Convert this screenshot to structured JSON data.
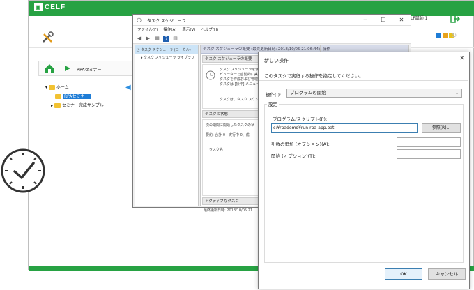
{
  "celf": {
    "logo": "CELF",
    "user": "CELF講師 1",
    "breadcrumb": "RPAセミナー",
    "tree": [
      {
        "label": "ホーム"
      },
      {
        "label": "RPAセミナー",
        "selected": true
      },
      {
        "label": "セミナー完成サンプル"
      }
    ],
    "brand_color": "#27a243"
  },
  "task_scheduler": {
    "title": "タスク スケジューラ",
    "menu": [
      "ファイル(F)",
      "操作(A)",
      "表示(V)",
      "ヘルプ(H)"
    ],
    "tree": [
      "タスク スケジューラ (ローカル)",
      "タスク スケジューラ ライブラリ"
    ],
    "mid_header": "タスク スケジューラの概要 (最終更新日時: 2018/10/05 21:06:44)",
    "overview_title": "タスク スケジューラの概要",
    "overview_text": [
      "タスク スケジューラを使用して、",
      "ピューターで自動的に実行",
      "タスクを作成および管理す",
      "タスクは [操作] メニュー"
    ],
    "overview_more": "タスクは、タスク スケジ",
    "status_title": "タスクの状態",
    "status_line1": "次の期間に開始したタスクの状",
    "status_line2": "要約: 合計 0 - 実行中 0、成",
    "task_col": "タスク名",
    "active_title": "アクティブなタスク",
    "footer": "最終更新日時: 2018/10/05 21",
    "right_header": "操作"
  },
  "dialog": {
    "title": "新しい操作",
    "close": "✕",
    "intro": "このタスクで実行する操作を指定してください。",
    "action_label": "操作(I):",
    "action_value": "プログラムの開始",
    "group_label": "設定",
    "program_label": "プログラム/スクリプト(P):",
    "program_value": "c:¥rpademo¥run-rpa-app.bat",
    "browse": "参照(R)...",
    "args_label": "引数の追加 (オプション)(A):",
    "start_label": "開始 (オプション)(T):",
    "ok": "OK",
    "cancel": "キャンセル"
  }
}
